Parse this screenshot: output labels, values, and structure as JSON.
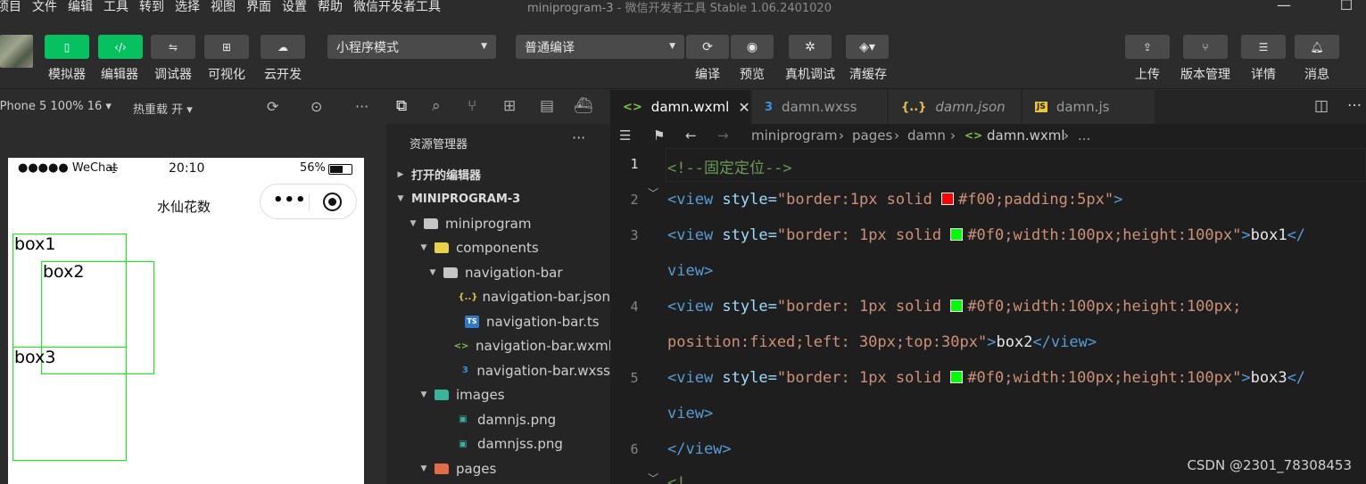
{
  "menubar": {
    "items": [
      "项目",
      "文件",
      "编辑",
      "工具",
      "转到",
      "选择",
      "视图",
      "界面",
      "设置",
      "帮助",
      "微信开发者工具"
    ],
    "title": "miniprogram-3",
    "title_suffix": " - 微信开发者工具 Stable 1.06.2401020",
    "minimize": "—",
    "maximize": "☐"
  },
  "toolbar": {
    "simulator": "模拟器",
    "editor": "编辑器",
    "debugger": "调试器",
    "visual": "可视化",
    "cloud": "云开发",
    "mode_select": "小程序模式",
    "compile_select": "普通编译",
    "compile": "编译",
    "preview": "预览",
    "real_debug": "真机调试",
    "clear_cache": "清缓存",
    "upload": "上传",
    "version": "版本管理",
    "details": "详情",
    "messages": "消息"
  },
  "simulator": {
    "device": "iPhone 5 100% 16",
    "hot_reload": "热重载 开",
    "more": "···",
    "status_carrier": "●●●●● WeChat",
    "status_time": "20:10",
    "status_battery": "56%",
    "nav_title": "水仙花数",
    "capsule_dots": "•••",
    "boxes": [
      "box1",
      "box2",
      "box3"
    ]
  },
  "explorer": {
    "header": "资源管理器",
    "more": "···",
    "rows": [
      {
        "label": "打开的编辑器",
        "section": true,
        "twist": "▶"
      },
      {
        "label": "MINIPROGRAM-3",
        "section": true,
        "twist": "▼"
      },
      {
        "label": "miniprogram",
        "twist": "▼",
        "icon": "folder",
        "color": "#c5c5c5"
      },
      {
        "label": "components",
        "twist": "▼",
        "icon": "folder",
        "color": "#e8d24a"
      },
      {
        "label": "navigation-bar",
        "twist": "▼",
        "icon": "folder",
        "color": "#c5c5c5"
      },
      {
        "label": "navigation-bar.json",
        "icon": "json",
        "glyph": "{..}",
        "color": "#e2c14a"
      },
      {
        "label": "navigation-bar.ts",
        "icon": "ts",
        "glyph": "TS",
        "color": "#3178c6"
      },
      {
        "label": "navigation-bar.wxml",
        "icon": "wxml",
        "glyph": "<>",
        "color": "#7bc24a"
      },
      {
        "label": "navigation-bar.wxss",
        "icon": "wxss",
        "glyph": "3",
        "color": "#3d8fe0"
      },
      {
        "label": "images",
        "twist": "▼",
        "icon": "folder",
        "color": "#3bb39b"
      },
      {
        "label": "damnjs.png",
        "icon": "image",
        "glyph": "▣",
        "color": "#3bb39b"
      },
      {
        "label": "damnjss.png",
        "icon": "image",
        "glyph": "▣",
        "color": "#3bb39b"
      },
      {
        "label": "pages",
        "twist": "▼",
        "icon": "folder",
        "color": "#e06c4a"
      }
    ]
  },
  "editor": {
    "tabs": [
      {
        "label": "damn.wxml",
        "glyph": "<>",
        "color": "#7bc24a",
        "active": true
      },
      {
        "label": "damn.wxss",
        "glyph": "3",
        "color": "#3d8fe0"
      },
      {
        "label": "damn.json",
        "glyph": "{..}",
        "color": "#e2c14a"
      },
      {
        "label": "damn.js",
        "glyph": "JS",
        "color": "#e8c53a"
      }
    ],
    "breadcrumb": [
      "miniprogram",
      "pages",
      "damn",
      "damn.wxml",
      "..."
    ],
    "line_numbers": [
      "1",
      "2",
      "3",
      "4",
      "5",
      "6"
    ],
    "code": {
      "l1": "<!--固定定位-->",
      "l2_tag": "<view",
      "l2_attr": " style=",
      "l2_str_a": "\"border:1px solid ",
      "l2_str_b": "#f00;padding:5px\"",
      "l2_end": ">",
      "l3_tag": "<view",
      "l3_attr": " style=",
      "l3_str_a": "\"border: 1px solid ",
      "l3_str_b": "#0f0;width:100px;height:100px\"",
      "l3_end": ">",
      "l3_text": "box1",
      "l3_close": "</",
      "l3b": "view>",
      "l4_tag": "<view",
      "l4_attr": " style=",
      "l4_str_a": "\"border: 1px solid ",
      "l4_str_b": "#0f0;width:100px;height:100px;",
      "l4b_str": "position:fixed;left: 30px;top:30px\"",
      "l4b_end": ">",
      "l4b_text": "box2",
      "l4b_close": "</view>",
      "l5_tag": "<view",
      "l5_attr": " style=",
      "l5_str_a": "\"border: 1px solid ",
      "l5_str_b": "#0f0;width:100px;height:100px\"",
      "l5_end": ">",
      "l5_text": "box3",
      "l5_close": "</",
      "l5b": "view>",
      "l6": "</view>",
      "l7": "<!"
    },
    "swatch_red": "#ff0000",
    "swatch_green": "#00ff00"
  },
  "watermark": "CSDN @2301_78308453"
}
